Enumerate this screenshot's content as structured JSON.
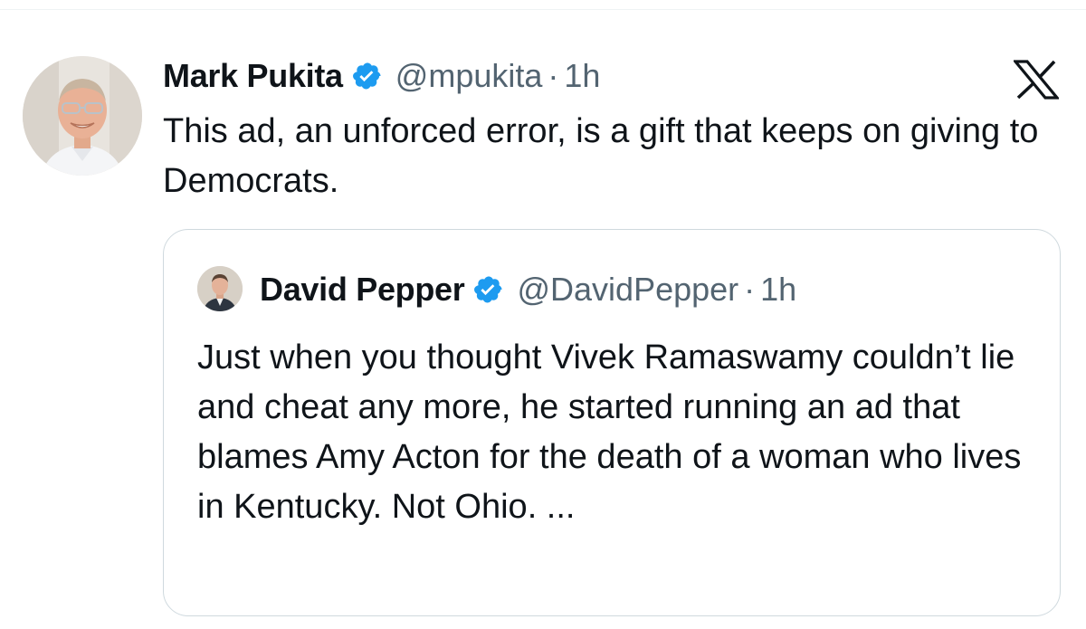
{
  "tweet": {
    "author_name": "Mark Pukita",
    "handle": "@mpukita",
    "separator": "·",
    "time": "1h",
    "text": "This ad, an unforced error, is a gift that keeps on giving to Democrats."
  },
  "quoted_tweet": {
    "author_name": "David Pepper",
    "handle": "@DavidPepper",
    "separator": "·",
    "time": "1h",
    "text": "Just when you thought Vivek Ramaswamy couldn’t lie and cheat any more, he started running an ad that blames Amy Acton for the death of a woman who lives in Kentucky. Not Ohio. ..."
  },
  "icons": {
    "verified": "verified-badge-icon",
    "platform": "x-logo-icon"
  },
  "colors": {
    "verified_blue": "#1d9bf0",
    "text_primary": "#0f1419",
    "text_secondary": "#536471",
    "border": "#cfd9de"
  }
}
